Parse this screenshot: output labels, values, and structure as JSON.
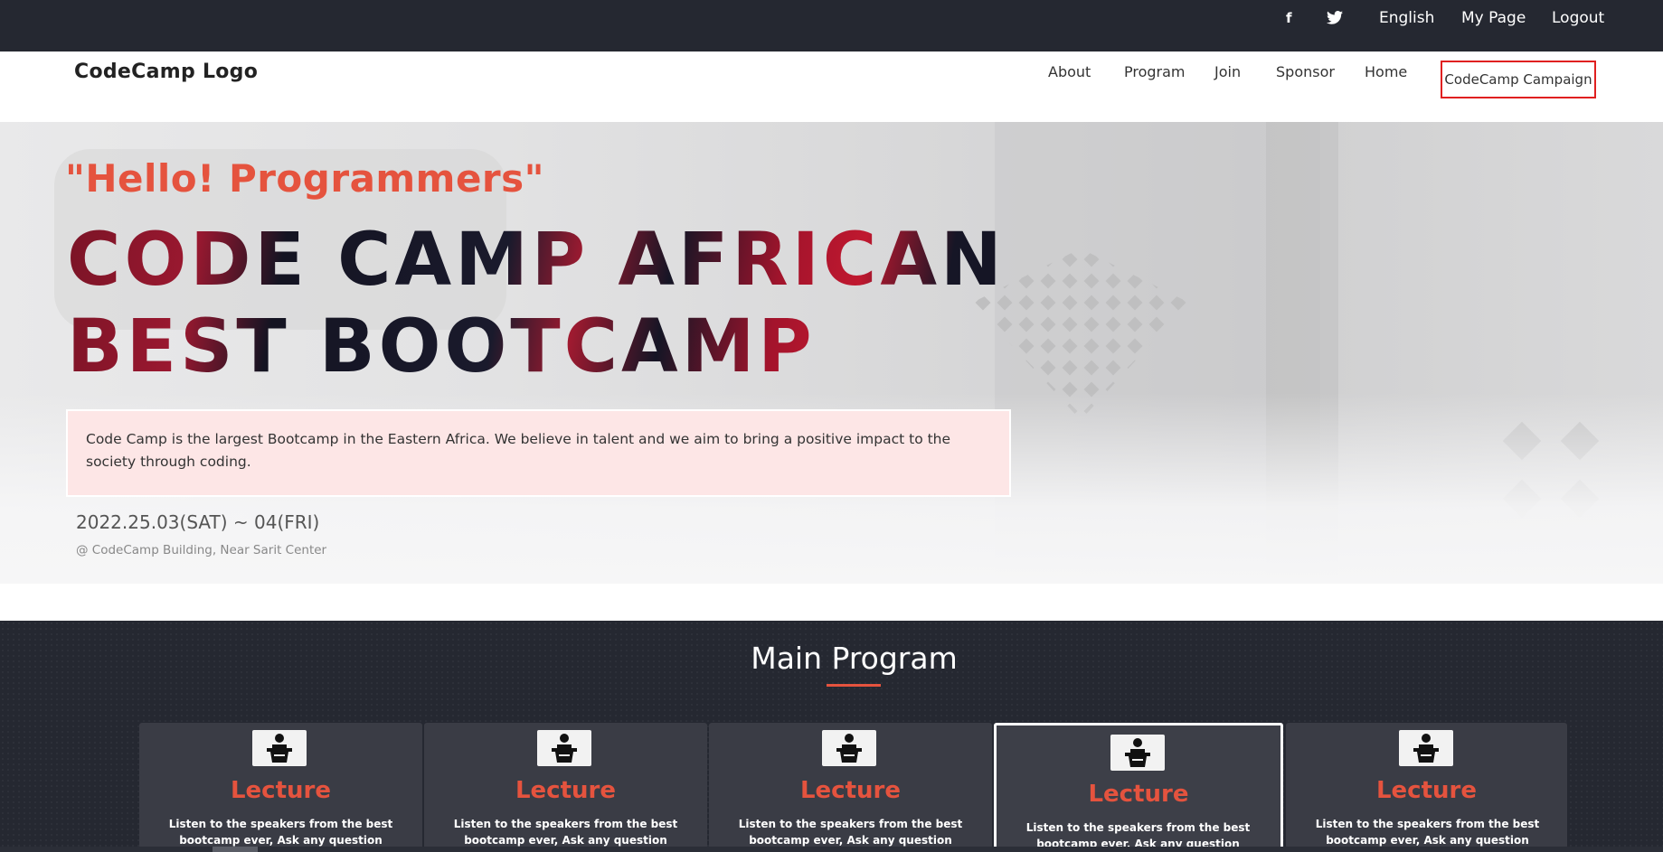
{
  "topbar": {
    "facebook": "f",
    "twitter_icon": "twitter-icon",
    "language": "English",
    "my_page": "My Page",
    "logout": "Logout"
  },
  "nav": {
    "logo": "CodeCamp Logo",
    "links": [
      "About",
      "Program",
      "Join",
      "Sponsor",
      "Home"
    ],
    "campaign": "CodeCamp Campaign"
  },
  "hero": {
    "greeting": "\"Hello! Programmers\"",
    "headline": "CODE CAMP AFRICAN BEST BOOTCAMP",
    "description": "Code Camp is the largest Bootcamp in the Eastern Africa. We believe in talent and we aim to bring a positive impact to the society through coding.",
    "date": "2022.25.03(SAT) ~ 04(FRI)",
    "venue": "@ CodeCamp Building, Near Sarit Center"
  },
  "program": {
    "title": "Main Program",
    "cards": [
      {
        "icon": "lectern-icon",
        "title": "Lecture",
        "text": "Listen to the speakers from the best bootcamp ever, Ask any question related to programming and"
      },
      {
        "icon": "lectern-icon",
        "title": "Lecture",
        "text": "Listen to the speakers from the best bootcamp ever, Ask any question related to programming and"
      },
      {
        "icon": "lectern-icon",
        "title": "Lecture",
        "text": "Listen to the speakers from the best bootcamp ever, Ask any question related to programming and"
      },
      {
        "icon": "lectern-icon",
        "title": "Lecture",
        "text": "Listen to the speakers from the best bootcamp ever, Ask any question related to programming and"
      },
      {
        "icon": "lectern-icon",
        "title": "Lecture",
        "text": "Listen to the speakers from the best bootcamp ever, Ask any question related to programming and"
      }
    ]
  },
  "colors": {
    "accent": "#e5533e",
    "dark_bar": "#252831",
    "campaign_border": "#e02020",
    "description_bg": "#fde6e6"
  }
}
